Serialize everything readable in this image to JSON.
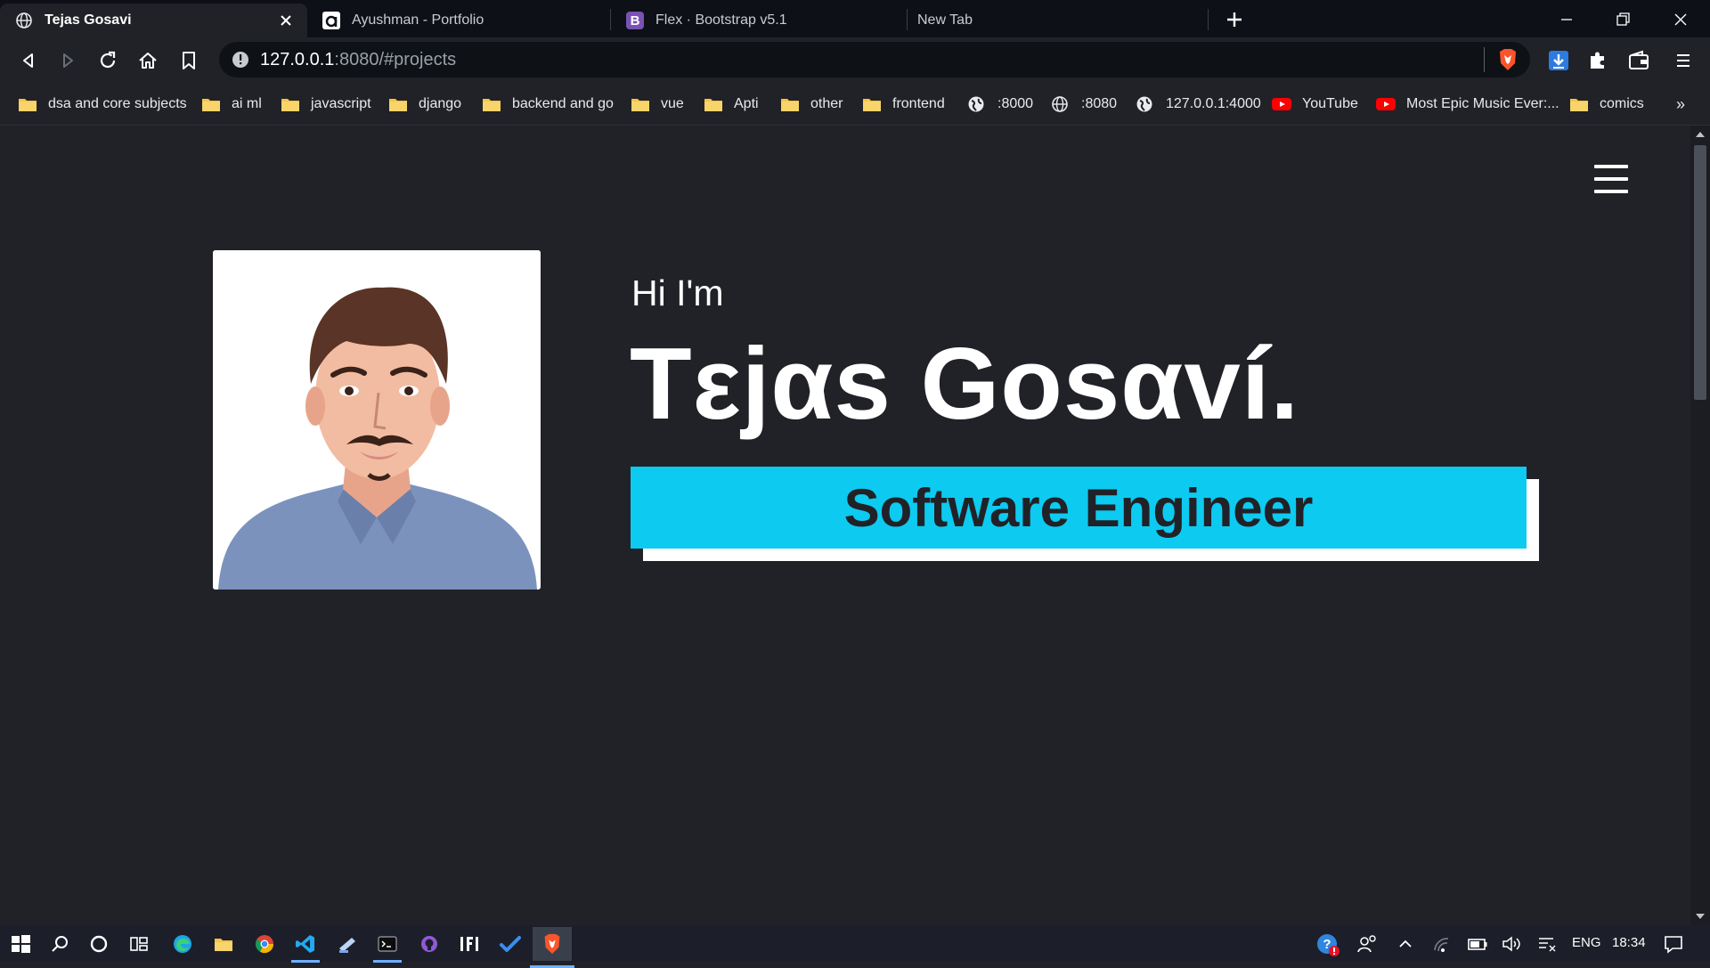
{
  "browser": {
    "tabs": [
      {
        "title": "Tejas Gosavi",
        "active": true,
        "favicon": "globe-icon"
      },
      {
        "title": "Ayushman - Portfolio",
        "active": false,
        "favicon": "portfolio-a-icon"
      },
      {
        "title": "Flex · Bootstrap v5.1",
        "active": false,
        "favicon": "bootstrap-icon"
      },
      {
        "title": "New Tab",
        "active": false,
        "favicon": ""
      }
    ],
    "address": {
      "host": "127.0.0.1",
      "rest": ":8080/#projects"
    },
    "bookmarks": [
      {
        "label": "dsa and core subjects",
        "icon": "folder-icon"
      },
      {
        "label": "ai ml",
        "icon": "folder-icon"
      },
      {
        "label": "javascript",
        "icon": "folder-icon"
      },
      {
        "label": "django",
        "icon": "folder-icon"
      },
      {
        "label": "backend and go",
        "icon": "folder-icon"
      },
      {
        "label": "vue",
        "icon": "folder-icon"
      },
      {
        "label": "Apti",
        "icon": "folder-icon"
      },
      {
        "label": "other",
        "icon": "folder-icon"
      },
      {
        "label": "frontend",
        "icon": "folder-icon"
      },
      {
        "label": ":8000",
        "icon": "globe-icon"
      },
      {
        "label": ":8080",
        "icon": "globe-icon"
      },
      {
        "label": "127.0.0.1:4000",
        "icon": "globe-icon"
      },
      {
        "label": "YouTube",
        "icon": "youtube-icon"
      },
      {
        "label": "Most Epic Music Ever:...",
        "icon": "youtube-icon"
      },
      {
        "label": "comics",
        "icon": "folder-icon"
      }
    ],
    "bookmarks_overflow": "»"
  },
  "hero": {
    "greeting": "Hi I'm",
    "name": "Tεjαs Gosαví.",
    "role": "Software Engineer"
  },
  "colors": {
    "page_bg": "#202227",
    "accent": "#0dcaf0",
    "text": "#ffffff"
  },
  "taskbar": {
    "language": "ENG",
    "time": "18:34"
  }
}
